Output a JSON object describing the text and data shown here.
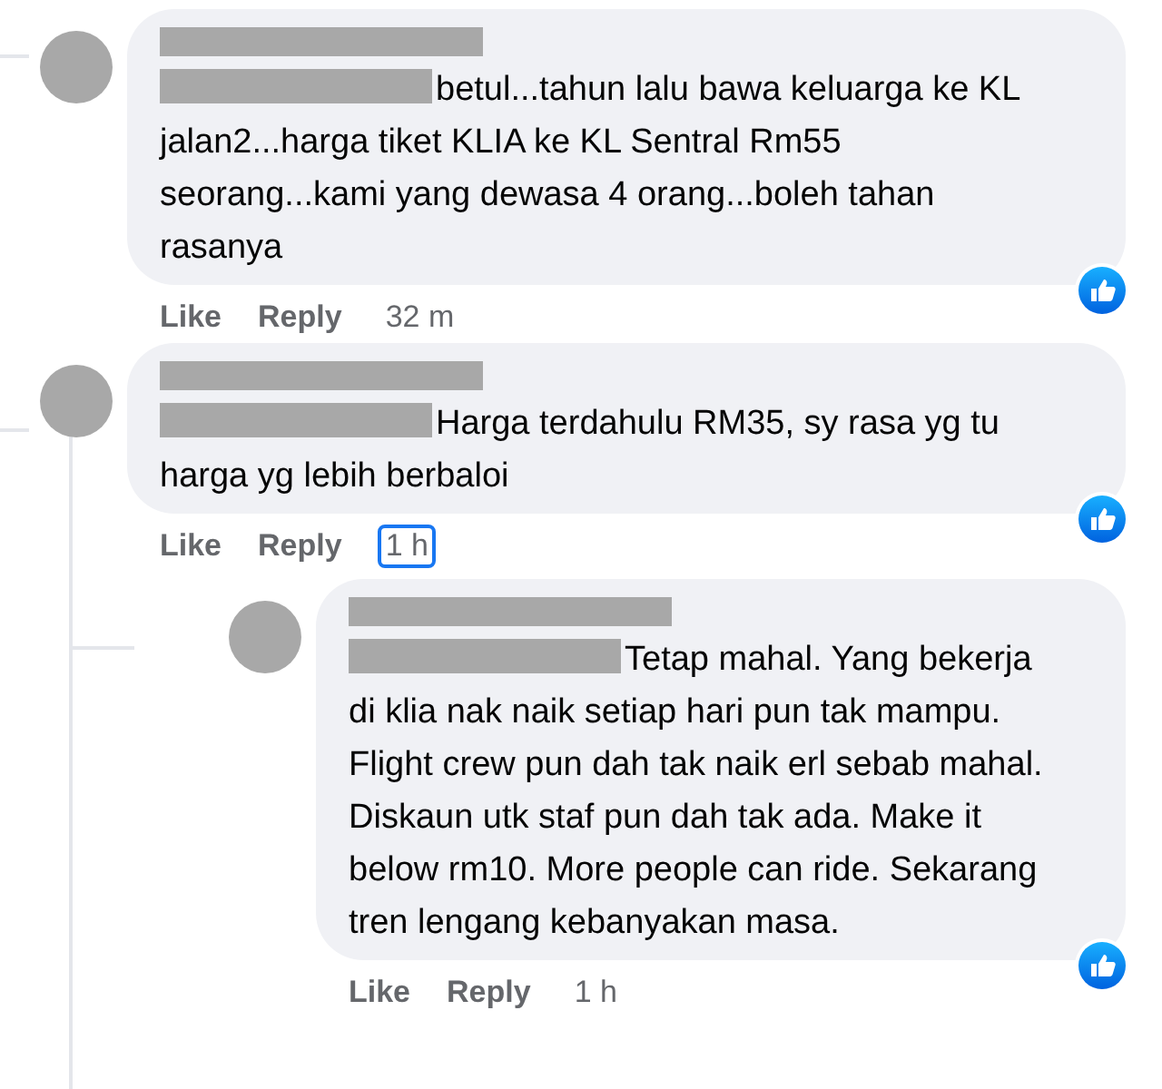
{
  "comments": [
    {
      "redacted_name": true,
      "redacted_mention": true,
      "text": "betul...tahun lalu bawa keluarga ke KL jalan2...harga tiket KLIA ke KL Sentral Rm55 seorang...kami yang dewasa 4 orang...boleh tahan rasanya",
      "liked": true,
      "actions": [
        "Like",
        "Reply"
      ],
      "time": "32 m",
      "time_focused": false
    },
    {
      "redacted_name": true,
      "redacted_mention": true,
      "text": "Harga terdahulu RM35, sy rasa yg tu harga yg lebih berbaloi",
      "liked": true,
      "actions": [
        "Like",
        "Reply"
      ],
      "time": "1 h",
      "time_focused": true,
      "replies": [
        {
          "redacted_name": true,
          "redacted_mention": true,
          "text": "Tetap mahal. Yang bekerja di klia nak naik setiap hari pun tak mampu. Flight crew pun dah tak naik erl sebab mahal. Diskaun utk staf pun dah tak ada. Make it below rm10. More people can ride. Sekarang tren lengang kebanyakan masa.",
          "liked": true,
          "actions": [
            "Like",
            "Reply"
          ],
          "time": "1 h",
          "time_focused": false
        }
      ]
    }
  ]
}
